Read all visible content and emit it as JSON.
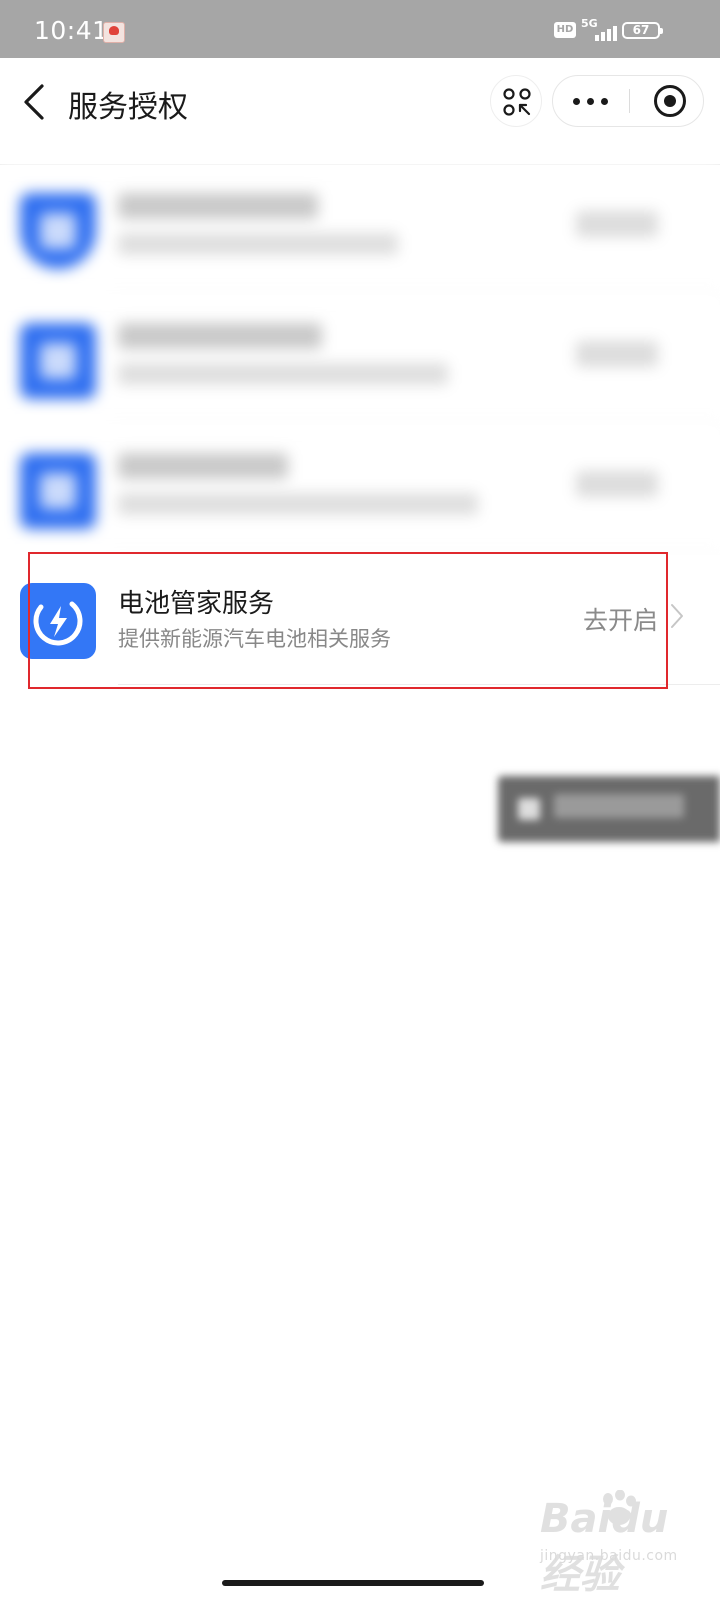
{
  "status_bar": {
    "time": "10:41",
    "hd_label": "HD",
    "network": "5G",
    "battery": "67"
  },
  "nav": {
    "title": "服务授权"
  },
  "services": [
    {
      "name": "",
      "description": "",
      "status": "",
      "blurred": true
    },
    {
      "name": "",
      "description": "",
      "status": "",
      "blurred": true
    },
    {
      "name": "",
      "description": "",
      "status": "",
      "blurred": true
    },
    {
      "name": "电池管家服务",
      "description": "提供新能源汽车电池相关服务",
      "status": "去开启",
      "blurred": false
    }
  ],
  "watermark": {
    "logo": "Baidu经验",
    "sub": "jingyan.baidu.com"
  },
  "colors": {
    "accent_blue": "#3377f6",
    "highlight_red": "#e0282d",
    "status_bar": "#a6a6a6"
  }
}
